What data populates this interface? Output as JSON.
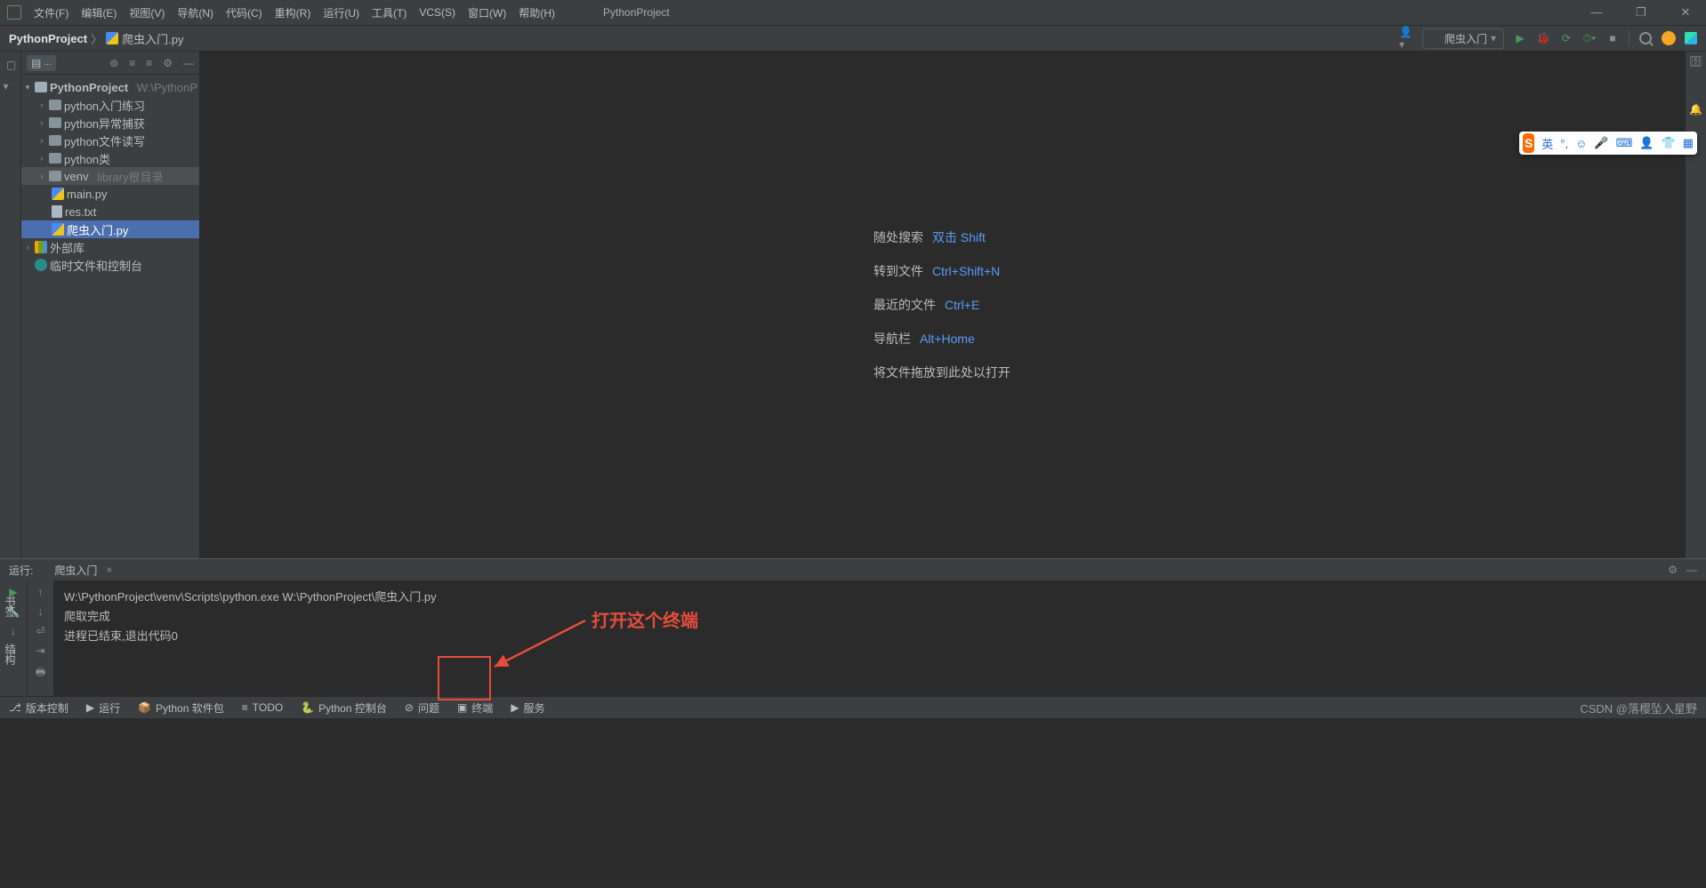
{
  "titlebar": {
    "menus": [
      "文件(F)",
      "编辑(E)",
      "视图(V)",
      "导航(N)",
      "代码(C)",
      "重构(R)",
      "运行(U)",
      "工具(T)",
      "VCS(S)",
      "窗口(W)",
      "帮助(H)"
    ],
    "app_name": "PythonProject"
  },
  "breadcrumb": {
    "root": "PythonProject",
    "file": "爬虫入门.py"
  },
  "run_config_selected": "爬虫入门",
  "project_tree": {
    "root": "PythonProject",
    "root_path": "W:\\PythonP",
    "folders": [
      "python入门练习",
      "python异常捕获",
      "python文件读写",
      "python类"
    ],
    "venv": {
      "name": "venv",
      "hint": "library根目录"
    },
    "files": [
      {
        "name": "main.py",
        "type": "py"
      },
      {
        "name": "res.txt",
        "type": "txt"
      },
      {
        "name": "爬虫入门.py",
        "type": "py",
        "selected": true
      }
    ],
    "external": "外部库",
    "scratch": "临时文件和控制台"
  },
  "editor_hints": [
    {
      "label": "随处搜索",
      "key": "双击 Shift"
    },
    {
      "label": "转到文件",
      "key": "Ctrl+Shift+N"
    },
    {
      "label": "最近的文件",
      "key": "Ctrl+E"
    },
    {
      "label": "导航栏",
      "key": "Alt+Home"
    }
  ],
  "editor_drop_hint": "将文件拖放到此处以打开",
  "run_panel": {
    "header_label": "运行:",
    "tab_name": "爬虫入门",
    "lines": [
      "W:\\PythonProject\\venv\\Scripts\\python.exe W:\\PythonProject\\爬虫入门.py",
      "爬取完成",
      "",
      "进程已结束,退出代码0"
    ]
  },
  "bottom_tabs": {
    "version_control": "版本控制",
    "run": "运行",
    "packages": "Python 软件包",
    "todo": "TODO",
    "console": "Python 控制台",
    "problems": "问题",
    "terminal": "终端",
    "services": "服务"
  },
  "watermark": "CSDN @落樱坠入星野",
  "annotation_text": "打开这个终端",
  "ime_lang": "英"
}
